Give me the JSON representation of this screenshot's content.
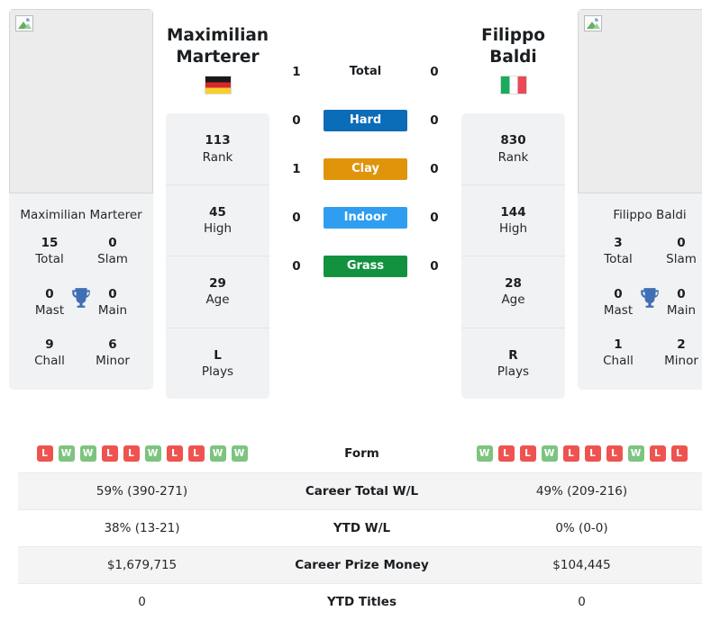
{
  "players": {
    "left": {
      "name": "Maximilian Marterer",
      "display_name_line1": "Maximilian",
      "display_name_line2": "Marterer",
      "flag": "flag-de",
      "photo_alt": "Maximilian Marterer",
      "stats": [
        {
          "value": "113",
          "label": "Rank"
        },
        {
          "value": "45",
          "label": "High"
        },
        {
          "value": "29",
          "label": "Age"
        },
        {
          "value": "L",
          "label": "Plays"
        }
      ],
      "titles": [
        {
          "value": "15",
          "label": "Total"
        },
        {
          "value": "0",
          "label": "Slam"
        },
        {
          "value": "0",
          "label": "Mast"
        },
        {
          "value": "0",
          "label": "Main"
        },
        {
          "value": "9",
          "label": "Chall"
        },
        {
          "value": "6",
          "label": "Minor"
        }
      ],
      "form": [
        "L",
        "W",
        "W",
        "L",
        "L",
        "W",
        "L",
        "L",
        "W",
        "W"
      ],
      "career_total_wl": "59% (390-271)",
      "ytd_wl": "38% (13-21)",
      "career_prize_money": "$1,679,715",
      "ytd_titles": "0"
    },
    "right": {
      "name": "Filippo Baldi",
      "display_name_line1": "Filippo Baldi",
      "display_name_line2": "",
      "flag": "flag-it",
      "photo_alt": "Filippo Baldi",
      "stats": [
        {
          "value": "830",
          "label": "Rank"
        },
        {
          "value": "144",
          "label": "High"
        },
        {
          "value": "28",
          "label": "Age"
        },
        {
          "value": "R",
          "label": "Plays"
        }
      ],
      "titles": [
        {
          "value": "3",
          "label": "Total"
        },
        {
          "value": "0",
          "label": "Slam"
        },
        {
          "value": "0",
          "label": "Mast"
        },
        {
          "value": "0",
          "label": "Main"
        },
        {
          "value": "1",
          "label": "Chall"
        },
        {
          "value": "2",
          "label": "Minor"
        }
      ],
      "form": [
        "W",
        "L",
        "L",
        "W",
        "L",
        "L",
        "L",
        "W",
        "L",
        "L"
      ],
      "career_total_wl": "49% (209-216)",
      "ytd_wl": "0% (0-0)",
      "career_prize_money": "$104,445",
      "ytd_titles": "0"
    }
  },
  "head_to_head": {
    "rows": [
      {
        "label": "Total",
        "left": "1",
        "right": "0",
        "style": "plain",
        "color": ""
      },
      {
        "label": "Hard",
        "left": "0",
        "right": "0",
        "style": "badge",
        "color": "#0b6cb8"
      },
      {
        "label": "Clay",
        "left": "1",
        "right": "0",
        "style": "badge",
        "color": "#e0940a"
      },
      {
        "label": "Indoor",
        "left": "0",
        "right": "0",
        "style": "badge",
        "color": "#2f9ef0"
      },
      {
        "label": "Grass",
        "left": "0",
        "right": "0",
        "style": "badge",
        "color": "#12923f"
      }
    ]
  },
  "comparison_table": {
    "rows": [
      {
        "label": "Form",
        "type": "form"
      },
      {
        "label": "Career Total W/L",
        "type": "text",
        "key": "career_total_wl"
      },
      {
        "label": "YTD W/L",
        "type": "text",
        "key": "ytd_wl"
      },
      {
        "label": "Career Prize Money",
        "type": "text",
        "key": "career_prize_money"
      },
      {
        "label": "YTD Titles",
        "type": "text",
        "key": "ytd_titles"
      }
    ]
  },
  "colors": {
    "hard": "#0b6cb8",
    "clay": "#e0940a",
    "indoor": "#2f9ef0",
    "grass": "#12923f",
    "win": "#7cc47f",
    "loss": "#ef5350",
    "card_bg": "#f1f2f3",
    "trophy": "#3f6fb5"
  }
}
